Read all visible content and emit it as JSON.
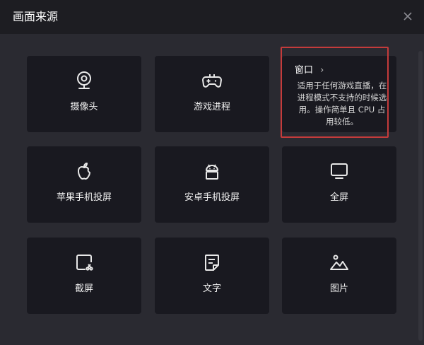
{
  "dialog": {
    "title": "画面来源"
  },
  "cards": [
    {
      "label": "摄像头",
      "icon": "webcam-icon"
    },
    {
      "label": "游戏进程",
      "icon": "gamepad-icon"
    },
    {
      "label": "窗口",
      "icon": "window-icon"
    },
    {
      "label": "苹果手机投屏",
      "icon": "apple-icon"
    },
    {
      "label": "安卓手机投屏",
      "icon": "android-icon"
    },
    {
      "label": "全屏",
      "icon": "monitor-icon"
    },
    {
      "label": "截屏",
      "icon": "screenshot-icon"
    },
    {
      "label": "文字",
      "icon": "text-document-icon"
    },
    {
      "label": "图片",
      "icon": "image-icon"
    }
  ],
  "window_tooltip": {
    "title": "窗口",
    "chevron": "›",
    "description": "适用于任何游戏直播，在进程模式不支持的时候选用。操作简单且 CPU 占用较低。"
  },
  "colors": {
    "background": "#2a2a31",
    "titlebar": "#1d1d22",
    "card": "#191920",
    "highlight_border": "#c43b3b",
    "text": "#ffffff"
  }
}
